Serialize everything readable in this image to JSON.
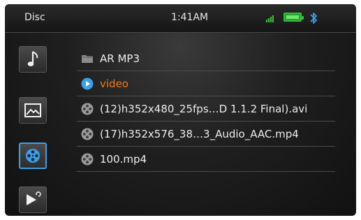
{
  "statusbar": {
    "source": "Disc",
    "time": "1:41AM",
    "signal_icon": "signal-bars-icon",
    "battery_icon": "battery-icon",
    "bluetooth_icon": "bluetooth-icon",
    "colors": {
      "signal": "#41c23b",
      "battery": "#2fbf3a",
      "bluetooth": "#3aa0e8"
    }
  },
  "sidebar": {
    "items": [
      {
        "icon": "music-note-icon",
        "active": false
      },
      {
        "icon": "picture-icon",
        "active": false
      },
      {
        "icon": "film-reel-icon",
        "active": true
      },
      {
        "icon": "play-back-icon",
        "active": false
      }
    ]
  },
  "files": [
    {
      "icon": "folder-icon",
      "label": "AR MP3"
    },
    {
      "icon": "play-circle-icon",
      "label": "video",
      "selected": true
    },
    {
      "icon": "film-reel-icon",
      "label": "(12)h352x480_25fps…D 1.1.2 Final).avi"
    },
    {
      "icon": "film-reel-icon",
      "label": "(17)h352x576_38…3_Audio_AAC.mp4"
    },
    {
      "icon": "film-reel-icon",
      "label": "100.mp4"
    }
  ],
  "colors": {
    "selected_text": "#f07a1a",
    "accent": "#3aa0e8"
  }
}
